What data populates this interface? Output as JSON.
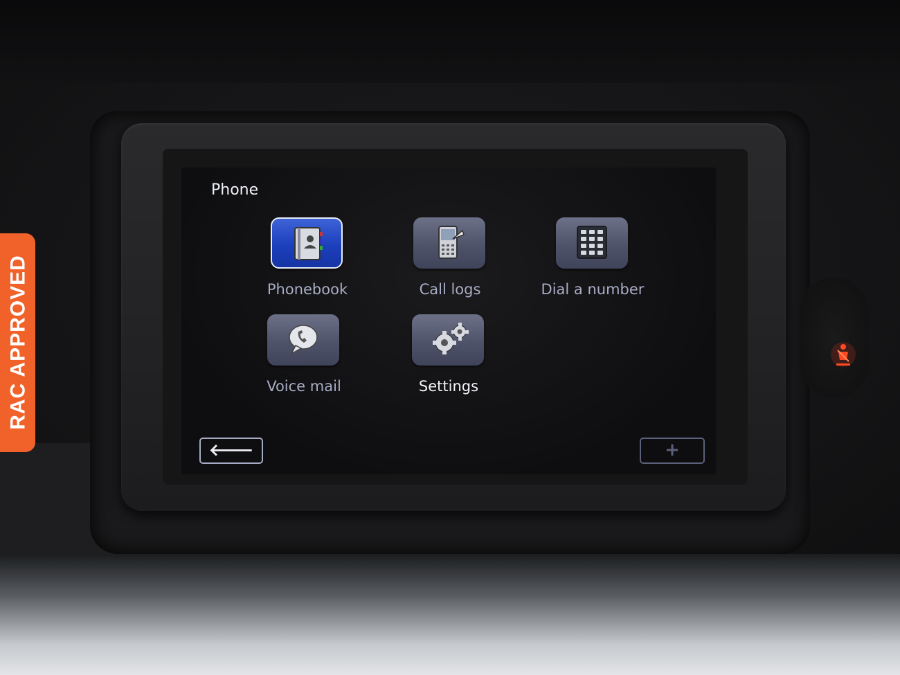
{
  "screen": {
    "title": "Phone",
    "tiles": [
      {
        "label": "Phonebook",
        "icon": "phonebook-icon",
        "selected": true
      },
      {
        "label": "Call logs",
        "icon": "call-logs-icon",
        "selected": false
      },
      {
        "label": "Dial a number",
        "icon": "keypad-icon",
        "selected": false
      },
      {
        "label": "Voice mail",
        "icon": "voice-mail-icon",
        "selected": false
      },
      {
        "label": "Settings",
        "icon": "gears-icon",
        "selected": false
      }
    ],
    "softkeys": {
      "back": "🡐",
      "add": "+"
    }
  },
  "badge": {
    "text": "RAC APPROVED",
    "color": "#f0622a"
  },
  "colors": {
    "selected_tile": "#1c3fbd",
    "tile": "#4f536a",
    "warning_light": "#ff3b1e"
  }
}
